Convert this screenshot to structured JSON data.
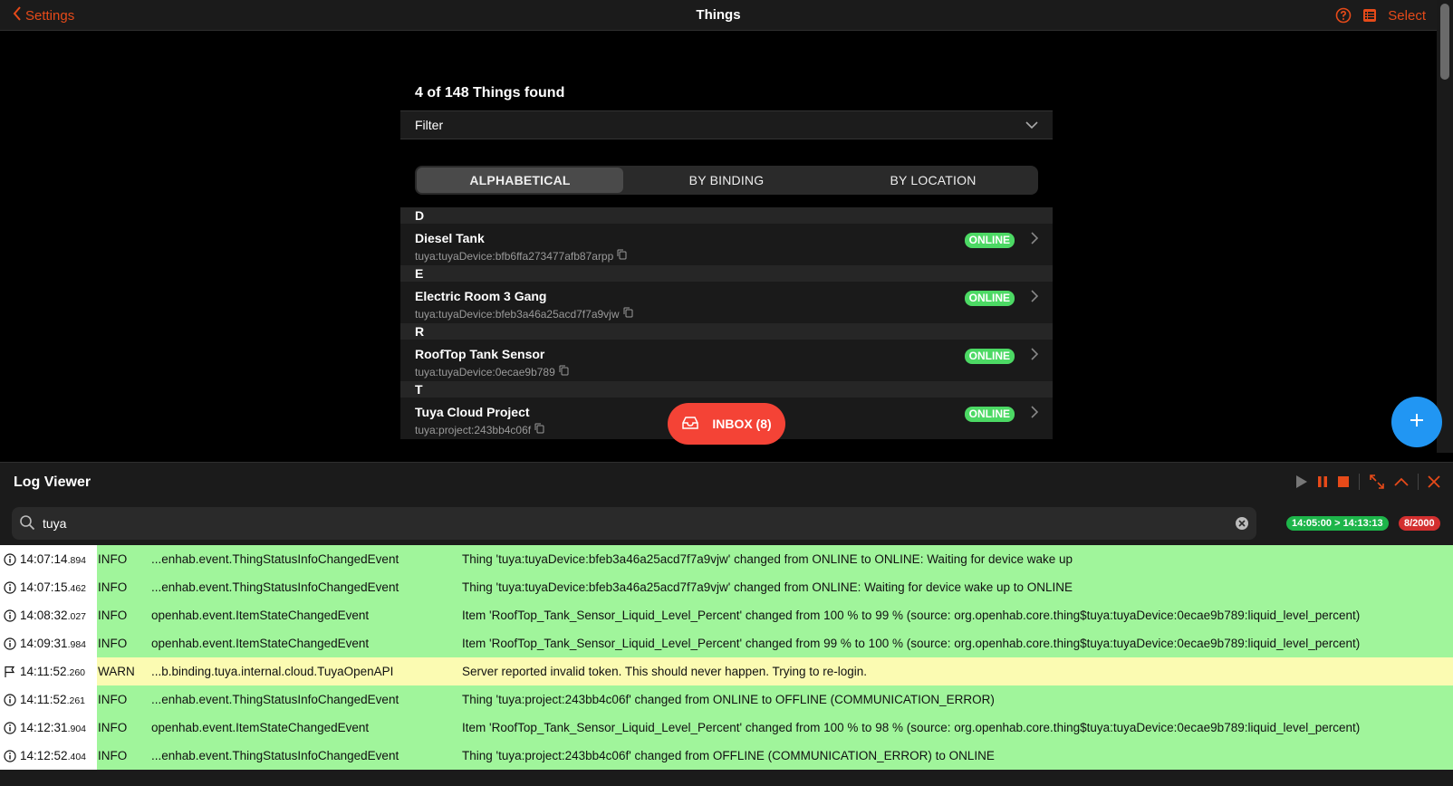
{
  "nav": {
    "back_label": "Settings",
    "title": "Things",
    "select_label": "Select"
  },
  "main": {
    "found_text": "4 of 148 Things found",
    "filter_label": "Filter",
    "tabs": [
      {
        "label": "ALPHABETICAL",
        "active": true
      },
      {
        "label": "BY BINDING",
        "active": false
      },
      {
        "label": "BY LOCATION",
        "active": false
      }
    ],
    "groups": [
      {
        "letter": "D",
        "items": [
          {
            "title": "Diesel Tank",
            "uid": "tuya:tuyaDevice:bfb6ffa273477afb87arpp",
            "status": "ONLINE"
          }
        ]
      },
      {
        "letter": "E",
        "items": [
          {
            "title": "Electric Room 3 Gang",
            "uid": "tuya:tuyaDevice:bfeb3a46a25acd7f7a9vjw",
            "status": "ONLINE"
          }
        ]
      },
      {
        "letter": "R",
        "items": [
          {
            "title": "RoofTop Tank Sensor",
            "uid": "tuya:tuyaDevice:0ecae9b789",
            "status": "ONLINE"
          }
        ]
      },
      {
        "letter": "T",
        "items": [
          {
            "title": "Tuya Cloud Project",
            "uid": "tuya:project:243bb4c06f",
            "status": "ONLINE"
          }
        ]
      }
    ],
    "inbox_label": "INBOX (8)"
  },
  "log_viewer": {
    "title": "Log Viewer",
    "search_value": "tuya",
    "time_range": "14:05:00 > 14:13:13",
    "count": "8/2000",
    "rows": [
      {
        "icon": "info-icon",
        "time": "14:07:14",
        "ms": ".894",
        "level": "INFO",
        "logger": "...enhab.event.ThingStatusInfoChangedEvent",
        "message": "Thing 'tuya:tuyaDevice:bfeb3a46a25acd7f7a9vjw' changed from ONLINE to ONLINE: Waiting for device wake up"
      },
      {
        "icon": "info-icon",
        "time": "14:07:15",
        "ms": ".462",
        "level": "INFO",
        "logger": "...enhab.event.ThingStatusInfoChangedEvent",
        "message": "Thing 'tuya:tuyaDevice:bfeb3a46a25acd7f7a9vjw' changed from ONLINE: Waiting for device wake up to ONLINE"
      },
      {
        "icon": "info-icon",
        "time": "14:08:32",
        "ms": ".027",
        "level": "INFO",
        "logger": "openhab.event.ItemStateChangedEvent",
        "message": "Item 'RoofTop_Tank_Sensor_Liquid_Level_Percent' changed from 100 % to 99 % (source: org.openhab.core.thing$tuya:tuyaDevice:0ecae9b789:liquid_level_percent)"
      },
      {
        "icon": "info-icon",
        "time": "14:09:31",
        "ms": ".984",
        "level": "INFO",
        "logger": "openhab.event.ItemStateChangedEvent",
        "message": "Item 'RoofTop_Tank_Sensor_Liquid_Level_Percent' changed from 99 % to 100 % (source: org.openhab.core.thing$tuya:tuyaDevice:0ecae9b789:liquid_level_percent)"
      },
      {
        "icon": "flag-icon",
        "time": "14:11:52",
        "ms": ".260",
        "level": "WARN",
        "logger": "...b.binding.tuya.internal.cloud.TuyaOpenAPI",
        "message": "Server reported invalid token. This should never happen. Trying to re-login."
      },
      {
        "icon": "info-icon",
        "time": "14:11:52",
        "ms": ".261",
        "level": "INFO",
        "logger": "...enhab.event.ThingStatusInfoChangedEvent",
        "message": "Thing 'tuya:project:243bb4c06f' changed from ONLINE to OFFLINE (COMMUNICATION_ERROR)"
      },
      {
        "icon": "info-icon",
        "time": "14:12:31",
        "ms": ".904",
        "level": "INFO",
        "logger": "openhab.event.ItemStateChangedEvent",
        "message": "Item 'RoofTop_Tank_Sensor_Liquid_Level_Percent' changed from 100 % to 98 % (source: org.openhab.core.thing$tuya:tuyaDevice:0ecae9b789:liquid_level_percent)"
      },
      {
        "icon": "info-icon",
        "time": "14:12:52",
        "ms": ".404",
        "level": "INFO",
        "logger": "...enhab.event.ThingStatusInfoChangedEvent",
        "message": "Thing 'tuya:project:243bb4c06f' changed from OFFLINE (COMMUNICATION_ERROR) to ONLINE"
      }
    ]
  },
  "colors": {
    "accent": "#e64a19",
    "online": "#4cd964",
    "fab": "#2196f3",
    "inbox": "#f44336",
    "info_row": "#a0f59b",
    "warn_row": "#fbfbb2"
  }
}
